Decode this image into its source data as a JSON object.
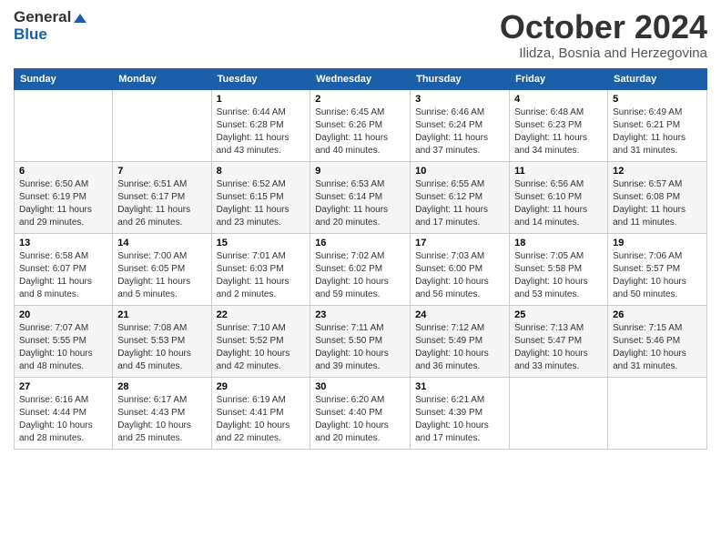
{
  "logo": {
    "general": "General",
    "blue": "Blue"
  },
  "header": {
    "month": "October 2024",
    "location": "Ilidza, Bosnia and Herzegovina"
  },
  "weekdays": [
    "Sunday",
    "Monday",
    "Tuesday",
    "Wednesday",
    "Thursday",
    "Friday",
    "Saturday"
  ],
  "weeks": [
    [
      {
        "day": "",
        "sunrise": "",
        "sunset": "",
        "daylight": ""
      },
      {
        "day": "",
        "sunrise": "",
        "sunset": "",
        "daylight": ""
      },
      {
        "day": "1",
        "sunrise": "Sunrise: 6:44 AM",
        "sunset": "Sunset: 6:28 PM",
        "daylight": "Daylight: 11 hours and 43 minutes."
      },
      {
        "day": "2",
        "sunrise": "Sunrise: 6:45 AM",
        "sunset": "Sunset: 6:26 PM",
        "daylight": "Daylight: 11 hours and 40 minutes."
      },
      {
        "day": "3",
        "sunrise": "Sunrise: 6:46 AM",
        "sunset": "Sunset: 6:24 PM",
        "daylight": "Daylight: 11 hours and 37 minutes."
      },
      {
        "day": "4",
        "sunrise": "Sunrise: 6:48 AM",
        "sunset": "Sunset: 6:23 PM",
        "daylight": "Daylight: 11 hours and 34 minutes."
      },
      {
        "day": "5",
        "sunrise": "Sunrise: 6:49 AM",
        "sunset": "Sunset: 6:21 PM",
        "daylight": "Daylight: 11 hours and 31 minutes."
      }
    ],
    [
      {
        "day": "6",
        "sunrise": "Sunrise: 6:50 AM",
        "sunset": "Sunset: 6:19 PM",
        "daylight": "Daylight: 11 hours and 29 minutes."
      },
      {
        "day": "7",
        "sunrise": "Sunrise: 6:51 AM",
        "sunset": "Sunset: 6:17 PM",
        "daylight": "Daylight: 11 hours and 26 minutes."
      },
      {
        "day": "8",
        "sunrise": "Sunrise: 6:52 AM",
        "sunset": "Sunset: 6:15 PM",
        "daylight": "Daylight: 11 hours and 23 minutes."
      },
      {
        "day": "9",
        "sunrise": "Sunrise: 6:53 AM",
        "sunset": "Sunset: 6:14 PM",
        "daylight": "Daylight: 11 hours and 20 minutes."
      },
      {
        "day": "10",
        "sunrise": "Sunrise: 6:55 AM",
        "sunset": "Sunset: 6:12 PM",
        "daylight": "Daylight: 11 hours and 17 minutes."
      },
      {
        "day": "11",
        "sunrise": "Sunrise: 6:56 AM",
        "sunset": "Sunset: 6:10 PM",
        "daylight": "Daylight: 11 hours and 14 minutes."
      },
      {
        "day": "12",
        "sunrise": "Sunrise: 6:57 AM",
        "sunset": "Sunset: 6:08 PM",
        "daylight": "Daylight: 11 hours and 11 minutes."
      }
    ],
    [
      {
        "day": "13",
        "sunrise": "Sunrise: 6:58 AM",
        "sunset": "Sunset: 6:07 PM",
        "daylight": "Daylight: 11 hours and 8 minutes."
      },
      {
        "day": "14",
        "sunrise": "Sunrise: 7:00 AM",
        "sunset": "Sunset: 6:05 PM",
        "daylight": "Daylight: 11 hours and 5 minutes."
      },
      {
        "day": "15",
        "sunrise": "Sunrise: 7:01 AM",
        "sunset": "Sunset: 6:03 PM",
        "daylight": "Daylight: 11 hours and 2 minutes."
      },
      {
        "day": "16",
        "sunrise": "Sunrise: 7:02 AM",
        "sunset": "Sunset: 6:02 PM",
        "daylight": "Daylight: 10 hours and 59 minutes."
      },
      {
        "day": "17",
        "sunrise": "Sunrise: 7:03 AM",
        "sunset": "Sunset: 6:00 PM",
        "daylight": "Daylight: 10 hours and 56 minutes."
      },
      {
        "day": "18",
        "sunrise": "Sunrise: 7:05 AM",
        "sunset": "Sunset: 5:58 PM",
        "daylight": "Daylight: 10 hours and 53 minutes."
      },
      {
        "day": "19",
        "sunrise": "Sunrise: 7:06 AM",
        "sunset": "Sunset: 5:57 PM",
        "daylight": "Daylight: 10 hours and 50 minutes."
      }
    ],
    [
      {
        "day": "20",
        "sunrise": "Sunrise: 7:07 AM",
        "sunset": "Sunset: 5:55 PM",
        "daylight": "Daylight: 10 hours and 48 minutes."
      },
      {
        "day": "21",
        "sunrise": "Sunrise: 7:08 AM",
        "sunset": "Sunset: 5:53 PM",
        "daylight": "Daylight: 10 hours and 45 minutes."
      },
      {
        "day": "22",
        "sunrise": "Sunrise: 7:10 AM",
        "sunset": "Sunset: 5:52 PM",
        "daylight": "Daylight: 10 hours and 42 minutes."
      },
      {
        "day": "23",
        "sunrise": "Sunrise: 7:11 AM",
        "sunset": "Sunset: 5:50 PM",
        "daylight": "Daylight: 10 hours and 39 minutes."
      },
      {
        "day": "24",
        "sunrise": "Sunrise: 7:12 AM",
        "sunset": "Sunset: 5:49 PM",
        "daylight": "Daylight: 10 hours and 36 minutes."
      },
      {
        "day": "25",
        "sunrise": "Sunrise: 7:13 AM",
        "sunset": "Sunset: 5:47 PM",
        "daylight": "Daylight: 10 hours and 33 minutes."
      },
      {
        "day": "26",
        "sunrise": "Sunrise: 7:15 AM",
        "sunset": "Sunset: 5:46 PM",
        "daylight": "Daylight: 10 hours and 31 minutes."
      }
    ],
    [
      {
        "day": "27",
        "sunrise": "Sunrise: 6:16 AM",
        "sunset": "Sunset: 4:44 PM",
        "daylight": "Daylight: 10 hours and 28 minutes."
      },
      {
        "day": "28",
        "sunrise": "Sunrise: 6:17 AM",
        "sunset": "Sunset: 4:43 PM",
        "daylight": "Daylight: 10 hours and 25 minutes."
      },
      {
        "day": "29",
        "sunrise": "Sunrise: 6:19 AM",
        "sunset": "Sunset: 4:41 PM",
        "daylight": "Daylight: 10 hours and 22 minutes."
      },
      {
        "day": "30",
        "sunrise": "Sunrise: 6:20 AM",
        "sunset": "Sunset: 4:40 PM",
        "daylight": "Daylight: 10 hours and 20 minutes."
      },
      {
        "day": "31",
        "sunrise": "Sunrise: 6:21 AM",
        "sunset": "Sunset: 4:39 PM",
        "daylight": "Daylight: 10 hours and 17 minutes."
      },
      {
        "day": "",
        "sunrise": "",
        "sunset": "",
        "daylight": ""
      },
      {
        "day": "",
        "sunrise": "",
        "sunset": "",
        "daylight": ""
      }
    ]
  ]
}
